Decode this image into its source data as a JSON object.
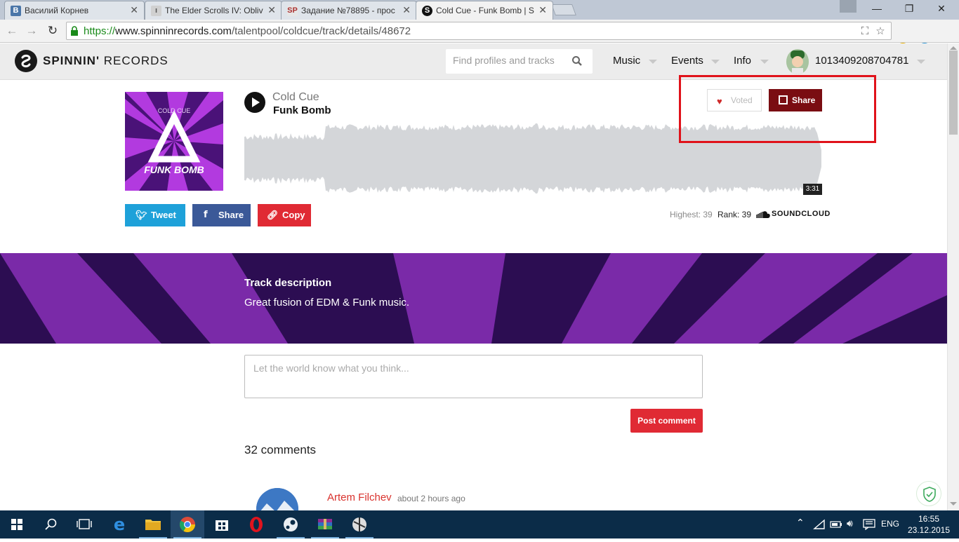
{
  "browser": {
    "tabs": [
      {
        "title": "Василий Корнев",
        "active": false,
        "favicon": "vk-icon"
      },
      {
        "title": "The Elder Scrolls IV: Oblivi",
        "active": false,
        "favicon": "page-icon"
      },
      {
        "title": "Задание №78895 - прос",
        "active": false,
        "favicon": "sp-icon"
      },
      {
        "title": "Cold Cue - Funk Bomb | Sp",
        "active": true,
        "favicon": "spinnin-icon"
      }
    ],
    "url": {
      "scheme": "https://",
      "host": "www.spinninrecords.com",
      "path": "/talentpool/coldcue/track/details/48672"
    }
  },
  "site": {
    "logo_bold": "SPINNIN'",
    "logo_rest": " RECORDS",
    "search_placeholder": "Find profiles and tracks",
    "nav": [
      "Music",
      "Events",
      "Info"
    ],
    "username": "1013409208704781"
  },
  "track": {
    "artist": "Cold Cue",
    "title": "Funk Bomb",
    "artwork_top_text": "COLD CUE",
    "artwork_bottom_text": "FUNK BOMB",
    "duration": "3:31",
    "vote_label": "Voted",
    "share_label": "Share",
    "highest_label": "Highest: 39",
    "rank_label": "Rank: 39",
    "soundcloud_label": "SOUNDCLOUD"
  },
  "social": {
    "tweet": "Tweet",
    "share": "Share",
    "copy": "Copy"
  },
  "description": {
    "title": "Track description",
    "text": "Great fusion of EDM & Funk music."
  },
  "comments": {
    "placeholder": "Let the world know what you think...",
    "post_label": "Post comment",
    "count_label": "32 comments",
    "first": {
      "author": "Artem Filchev",
      "time": "about 2 hours ago"
    }
  },
  "taskbar": {
    "lang": "ENG",
    "time": "16:55",
    "date": "23.12.2015"
  },
  "colors": {
    "vote_red": "#7a0d12",
    "highlight": "#e0121a",
    "band_purple": "#2c0d52",
    "twitter": "#1ea1d9",
    "facebook": "#3b5998",
    "copy": "#e02a34"
  }
}
